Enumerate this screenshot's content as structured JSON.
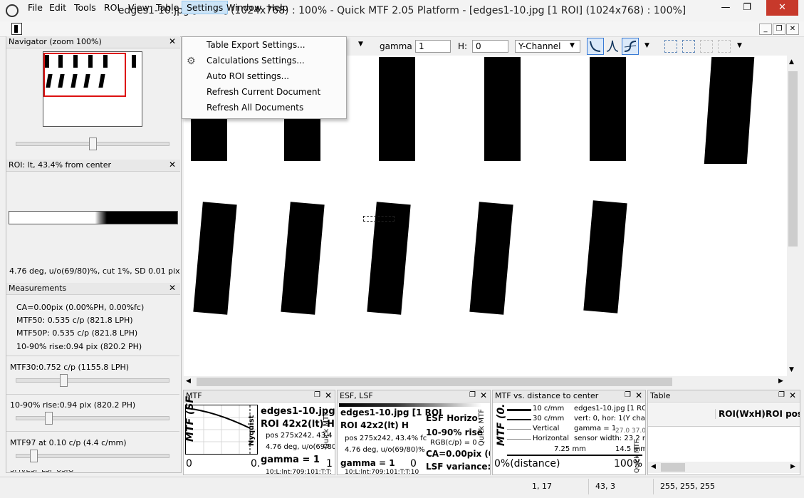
{
  "window": {
    "title": "edges1-10.jpg [1 ROI] (1024x768) : 100% - Quick MTF 2.05 Platform - [edges1-10.jpg [1 ROI] (1024x768) : 100%]",
    "minimize": "—",
    "maximize": "❐",
    "close": "✕"
  },
  "menu": [
    "File",
    "Edit",
    "Tools",
    "ROI",
    "View",
    "Table",
    "Settings",
    "Window",
    "Help"
  ],
  "settings_menu": [
    "Table Export Settings...",
    "Calculations Settings...",
    "Auto ROI settings...",
    "Refresh Current Document",
    "Refresh All Documents"
  ],
  "toolbar": {
    "gamma_label": "gamma",
    "gamma_value": "1",
    "h_label": "H:",
    "h_value": "0",
    "channel": "Y-Channel"
  },
  "navigator": {
    "title": "Navigator (zoom 100%)"
  },
  "roi_panel": {
    "title": "ROI: lt, 43.4% from center",
    "info": "4.76 deg, u/o(69/80)%, cut 1%, SD 0.01 pix"
  },
  "measurements": {
    "title": "Measurements",
    "lines": [
      "CA=0.00pix (0.00%PH, 0.00%fc)",
      "MTF50: 0.535 c/p (821.8 LPH)",
      "MTF50P: 0.535 c/p (821.8 LPH)",
      "10-90% rise:0.94 pix (820.2 PH)"
    ],
    "slider1": "MTF30:0.752 c/p (1155.8 LPH)",
    "slider2": "10-90% rise:0.94 pix (820.2 PH)",
    "slider3": "MTF97 at 0.10 c/p (4.4 c/mm)",
    "cut_off": "SFR/ESF LSF USIG"
  },
  "mtf_panel": {
    "title": "MTF",
    "file": "edges1-10.jpg",
    "roi": "ROI 42x2(lt) H",
    "pos": "pos 275x242, 43.4",
    "deg": "4.76 deg, u/o(69/80)",
    "gamma": "gamma = 1",
    "axis_left": "0",
    "axis_mid": "0.",
    "axis_right": "1",
    "nyquist": "Nyquist",
    "watermark": "Quick MTF",
    "y_label": "MTF (SF",
    "bottom": "10:L:lnt:709:101:T:T:"
  },
  "esf_panel": {
    "title": "ESF, LSF",
    "file": "edges1-10.jpg [1 ROI",
    "roi": "ROI 42x2(lt) H",
    "esf_title": "ESF Horizo",
    "rise": "10-90% rise",
    "pos": "pos 275x242, 43.4% fc",
    "rgb": "RGB(c/p) = 0",
    "deg": "4.76 deg, u/o(69/80)%",
    "ca": "CA=0.00pix (0.",
    "lsf": "LSF variance:",
    "gamma": "gamma = 1",
    "axis_left": "0",
    "bottom": "10:L:lnt:709:101:T:T:10",
    "watermark": "Quick MTF"
  },
  "dist_panel": {
    "title": "MTF vs. distance to center",
    "legend": [
      "10 c/mm",
      "30 c/mm",
      "Vertical",
      "Horizontal"
    ],
    "file": "edges1-10.jpg [1 RO",
    "vert": "vert: 0, hor: 1(Y cha",
    "gamma": "gamma = 1",
    "gamma_extra": "27.0 37.0",
    "sensor": "sensor width: 23.2 m",
    "mm_left": "7.25 mm",
    "mm_right": "14.5 mm",
    "axis_left": "0%(distance)",
    "axis_right": "100%",
    "y_label": "MTF (0.",
    "watermark": "Quick MTF"
  },
  "table_panel": {
    "title": "Table",
    "columns": [
      "ROI(WxH)",
      "ROI pos"
    ]
  },
  "status": {
    "a": "1, 17",
    "b": "43, 3",
    "c": "255, 255, 255"
  }
}
